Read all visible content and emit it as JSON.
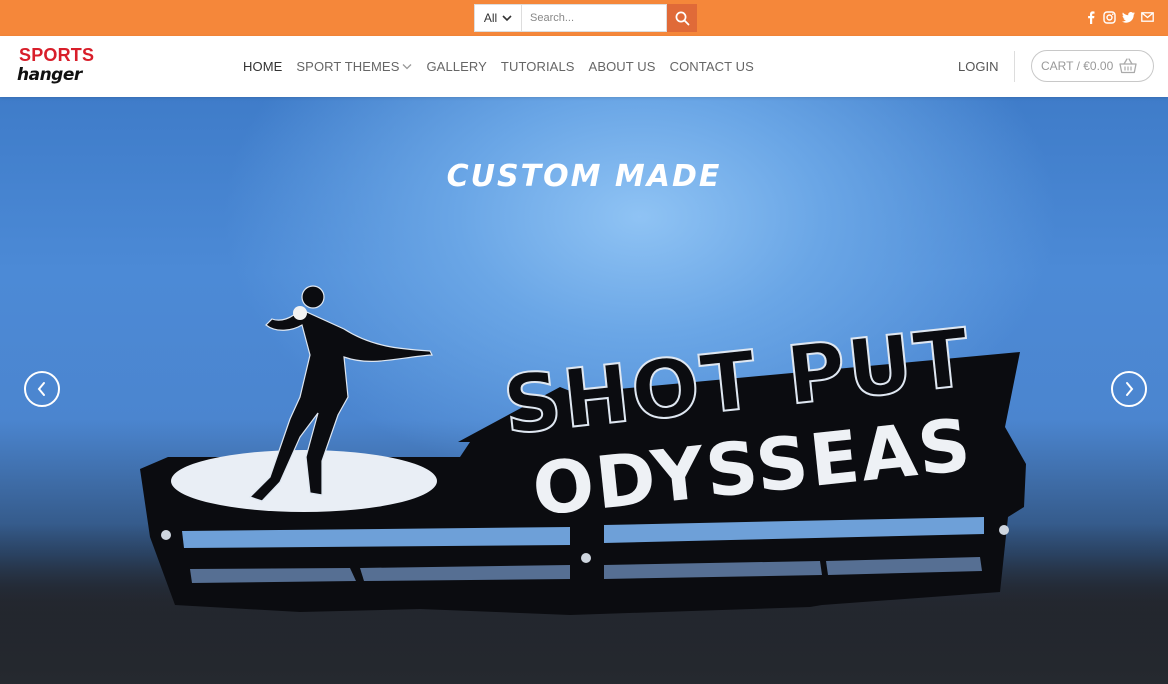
{
  "search": {
    "category_selected": "All",
    "placeholder": "Search..."
  },
  "social_icons": [
    "facebook-icon",
    "instagram-icon",
    "twitter-icon",
    "email-icon"
  ],
  "logo": {
    "line1": "SPORTS",
    "line2": "hanger"
  },
  "nav": {
    "items": [
      {
        "label": "HOME",
        "active": true
      },
      {
        "label": "SPORT THEMES",
        "has_dropdown": true
      },
      {
        "label": "GALLERY"
      },
      {
        "label": "TUTORIALS"
      },
      {
        "label": "ABOUT US"
      },
      {
        "label": "CONTACT US"
      }
    ]
  },
  "account": {
    "login_label": "LOGIN",
    "cart_label": "CART / €0.00"
  },
  "hero": {
    "title": "CUSTOM MADE",
    "product_line1": "SHOT PUT",
    "product_line2": "ODYSSEAS"
  },
  "colors": {
    "topbar": "#f5873a",
    "search_button": "#e06a38",
    "logo_red": "#d81e2a"
  }
}
